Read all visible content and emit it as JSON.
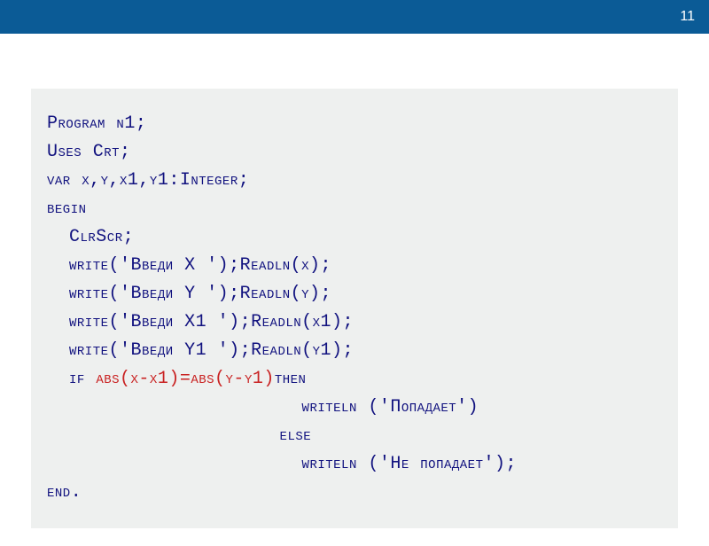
{
  "slide_number": "11",
  "code": {
    "l1": "Program n1;",
    "l2": "Uses Crt;",
    "l3": "var x,y,x1,y1:Integer;",
    "l4": "begin",
    "l5": "  ClrScr;",
    "l6": "  write('Введи X ');Readln(x);",
    "l7": "  write('Введи Y ');Readln(y);",
    "l8": "  write('Введи X1 ');Readln(x1);",
    "l9": "  write('Введи Y1 ');Readln(y1);",
    "l10a": "  if ",
    "l10b": "abs(x-x1)=abs(y-y1)",
    "l10c": "then",
    "l11": "                       writeln ('Попадает')",
    "l12": "                     else",
    "l13": "                       writeln ('Не попадает');",
    "l14": "end."
  }
}
